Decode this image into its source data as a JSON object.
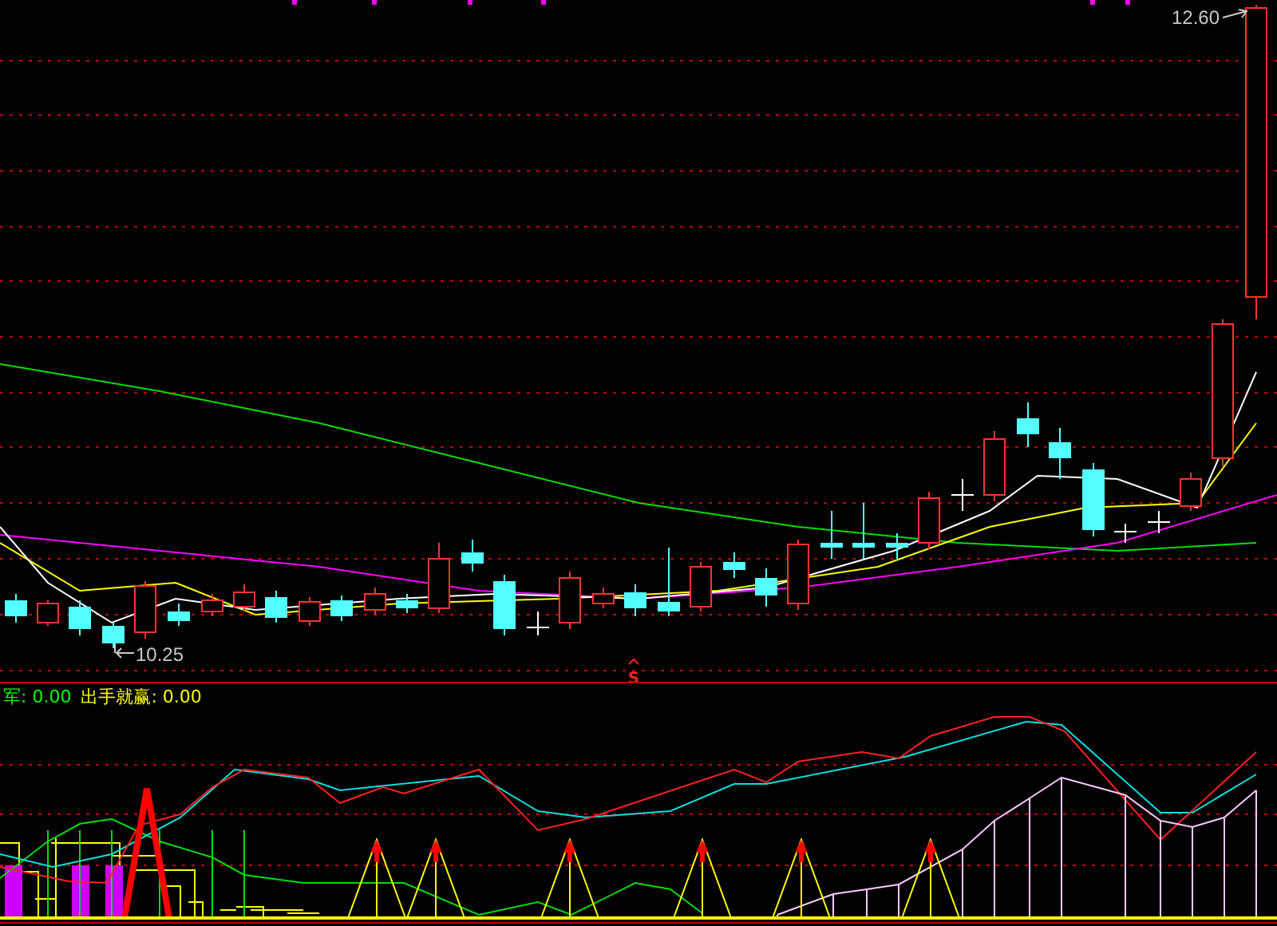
{
  "price_labels": [
    {
      "kind": "high",
      "text": "12.60"
    },
    {
      "kind": "low",
      "text": "10.25"
    }
  ],
  "signal_marker": {
    "text": "S"
  },
  "indicators": [
    {
      "label": "军:",
      "value": "0.00",
      "color": "#00ff00"
    },
    {
      "label": "出手就赢:",
      "value": "0.00",
      "color": "#ffff00"
    }
  ]
}
